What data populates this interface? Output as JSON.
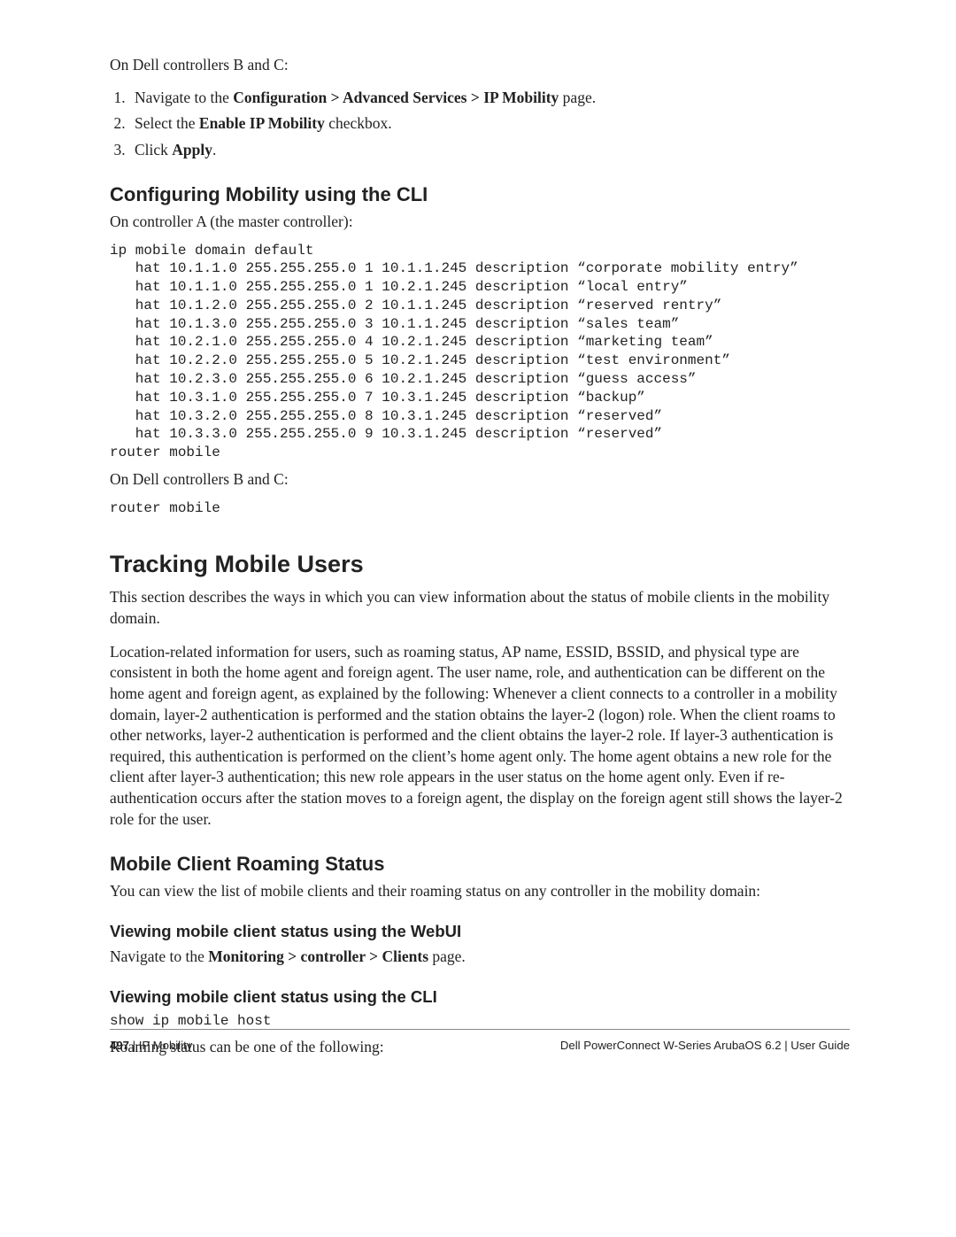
{
  "intro": "On Dell controllers B and C:",
  "steps": {
    "s1_pre": "Navigate to the ",
    "s1_bold": "Configuration > Advanced Services > IP Mobility",
    "s1_post": " page.",
    "s2_pre": "Select the ",
    "s2_bold": "Enable IP Mobility",
    "s2_post": " checkbox.",
    "s3_pre": "Click ",
    "s3_bold": "Apply",
    "s3_post": "."
  },
  "cli_heading": "Configuring Mobility using the CLI",
  "cli_intro": "On controller A (the master controller):",
  "cli_block": "ip mobile domain default\n   hat 10.1.1.0 255.255.255.0 1 10.1.1.245 description “corporate mobility entry”\n   hat 10.1.1.0 255.255.255.0 1 10.2.1.245 description “local entry”\n   hat 10.1.2.0 255.255.255.0 2 10.1.1.245 description “reserved rentry”\n   hat 10.1.3.0 255.255.255.0 3 10.1.1.245 description “sales team”\n   hat 10.2.1.0 255.255.255.0 4 10.2.1.245 description “marketing team”\n   hat 10.2.2.0 255.255.255.0 5 10.2.1.245 description “test environment”\n   hat 10.2.3.0 255.255.255.0 6 10.2.1.245 description “guess access”\n   hat 10.3.1.0 255.255.255.0 7 10.3.1.245 description “backup”\n   hat 10.3.2.0 255.255.255.0 8 10.3.1.245 description “reserved”\n   hat 10.3.3.0 255.255.255.0 9 10.3.1.245 description “reserved”\nrouter mobile",
  "cli_after": "On Dell controllers B and C:",
  "cli_block2": "router mobile",
  "track_heading": "Tracking Mobile Users",
  "track_p1": "This section describes the ways in which you can view information about the status of mobile clients in the mobility domain.",
  "track_p2": "Location-related information for users, such as roaming status, AP name, ESSID, BSSID, and physical type are consistent in both the home agent and foreign agent. The user name, role, and authentication can be different on the home agent and foreign agent, as explained by the following: Whenever a client connects to a controller in a mobility domain, layer-2 authentication is performed and the station obtains the layer-2 (logon) role. When the client roams to other networks, layer-2 authentication is performed and the client obtains the layer-2 role. If layer-3 authentication is required, this authentication is performed on the client’s home agent only. The home agent obtains a new role for the client after layer-3 authentication; this new role appears in the user status on the home agent only. Even if re-authentication occurs after the station moves to a foreign agent, the display on the foreign agent still shows the layer-2 role for the user.",
  "roam_heading": "Mobile Client Roaming Status",
  "roam_p": "You can view the list of mobile clients and their roaming status on any controller in the mobility domain:",
  "webui_heading": "Viewing mobile client status using the WebUI",
  "webui_p_pre": "Navigate to the ",
  "webui_p_bold": "Monitoring > controller > Clients",
  "webui_p_post": " page.",
  "clistat_heading": "Viewing mobile client status using the CLI",
  "clistat_code": "show ip mobile host",
  "clistat_p": "Roaming status can be one of the following:",
  "footer": {
    "page": "497",
    "section": " | IP Mobility",
    "right": "Dell PowerConnect W-Series ArubaOS 6.2  |  User Guide"
  }
}
